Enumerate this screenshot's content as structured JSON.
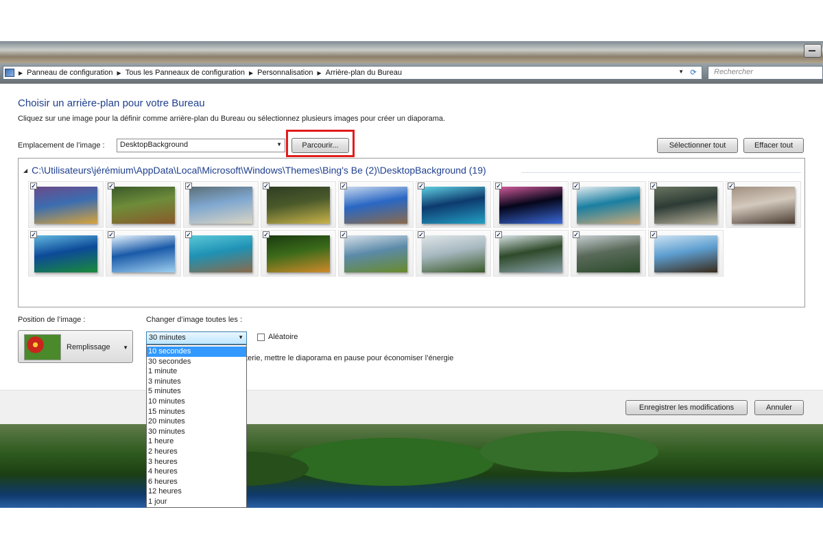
{
  "address_bar": {
    "crumbs": [
      "Panneau de configuration",
      "Tous les Panneaux de configuration",
      "Personnalisation",
      "Arrière-plan du Bureau"
    ],
    "search_placeholder": "Rechercher"
  },
  "header": {
    "title": "Choisir un arrière-plan pour votre Bureau",
    "subtitle": "Cliquez sur une image pour la définir comme arrière-plan du Bureau ou sélectionnez plusieurs images pour créer un diaporama."
  },
  "location": {
    "label": "Emplacement de l’image :",
    "value": "DesktopBackground",
    "browse_label": "Parcourir...",
    "select_all_label": "Sélectionner tout",
    "clear_all_label": "Effacer tout"
  },
  "gallery": {
    "path": "C:\\Utilisateurs\\jérémium\\AppData\\Local\\Microsoft\\Windows\\Themes\\Bing's Be (2)\\DesktopBackground (19)",
    "thumbnails": [
      {
        "name": "lavender-field",
        "checked": true,
        "colors": [
          "#3b6db0",
          "#d8a33a",
          "#6a4a8a"
        ]
      },
      {
        "name": "moai-statue",
        "checked": true,
        "colors": [
          "#6e8c3a",
          "#8a5a2a",
          "#3a5a2a"
        ]
      },
      {
        "name": "chateau-reflection",
        "checked": true,
        "colors": [
          "#7fa7d0",
          "#d9d4c3",
          "#5c6f78"
        ]
      },
      {
        "name": "bird-water",
        "checked": true,
        "colors": [
          "#4b5a2a",
          "#c9b34a",
          "#2f3d24"
        ]
      },
      {
        "name": "brooklyn-bridge",
        "checked": true,
        "colors": [
          "#2a68c4",
          "#8a6a4a",
          "#c7d8ee"
        ]
      },
      {
        "name": "blue-hole",
        "checked": true,
        "colors": [
          "#0d3a6e",
          "#23a0c4",
          "#5fd0e3"
        ]
      },
      {
        "name": "nebula",
        "checked": true,
        "colors": [
          "#05061a",
          "#3a6ad8",
          "#d05a9a"
        ]
      },
      {
        "name": "coast-aerial",
        "checked": true,
        "colors": [
          "#1a7fa2",
          "#c9a97a",
          "#e3ecef"
        ]
      },
      {
        "name": "storm-cloud",
        "checked": true,
        "colors": [
          "#2c3b35",
          "#b7b09a",
          "#6a7560"
        ]
      },
      {
        "name": "baby-turtle",
        "checked": true,
        "colors": [
          "#d4c9bd",
          "#4a3c30",
          "#a09080"
        ]
      },
      {
        "name": "tropical-island",
        "checked": true,
        "colors": [
          "#0c4a98",
          "#1b8a3a",
          "#62b8e0"
        ]
      },
      {
        "name": "glacier-ice",
        "checked": true,
        "colors": [
          "#1a5aa8",
          "#9fd0f0",
          "#e9f5ff"
        ]
      },
      {
        "name": "sea-fort",
        "checked": true,
        "colors": [
          "#1f92b5",
          "#8a6a4a",
          "#5ac8d8"
        ]
      },
      {
        "name": "tiger-jungle",
        "checked": true,
        "colors": [
          "#3a6a1a",
          "#d08a2a",
          "#1a3a10"
        ]
      },
      {
        "name": "savanna-trees",
        "checked": true,
        "colors": [
          "#5b8aa8",
          "#6a8a2a",
          "#d7e0ea"
        ]
      },
      {
        "name": "fog-valley",
        "checked": true,
        "colors": [
          "#a7b8c0",
          "#3a5a2a",
          "#dfe6e8"
        ]
      },
      {
        "name": "waterfall-cliff",
        "checked": true,
        "colors": [
          "#2e4a2a",
          "#8aa0a8",
          "#d8e2e6"
        ]
      },
      {
        "name": "fjord-mountains",
        "checked": true,
        "colors": [
          "#5a6a5a",
          "#2a4a2a",
          "#c7ced2"
        ]
      },
      {
        "name": "sea-otters",
        "checked": true,
        "colors": [
          "#5d9ed0",
          "#3a2a1a",
          "#cde2f2"
        ]
      }
    ]
  },
  "position": {
    "label": "Position de l’image :",
    "value": "Remplissage"
  },
  "interval": {
    "label": "Changer d’image toutes les :",
    "value": "30 minutes",
    "random_label": "Aléatoire",
    "battery_text": "tterie, mettre le diaporama en pause pour économiser l’énergie",
    "options": [
      "10 secondes",
      "30 secondes",
      "1 minute",
      "3 minutes",
      "5 minutes",
      "10 minutes",
      "15 minutes",
      "20 minutes",
      "30 minutes",
      "1 heure",
      "2 heures",
      "3 heures",
      "4 heures",
      "6 heures",
      "12 heures",
      "1 jour"
    ],
    "highlighted_option": "10 secondes"
  },
  "footer": {
    "save_label": "Enregistrer les modifications",
    "cancel_label": "Annuler"
  },
  "colors": {
    "title_blue": "#1e3f8e",
    "highlight_red": "#e11b1b",
    "selection_blue": "#3399ff"
  }
}
